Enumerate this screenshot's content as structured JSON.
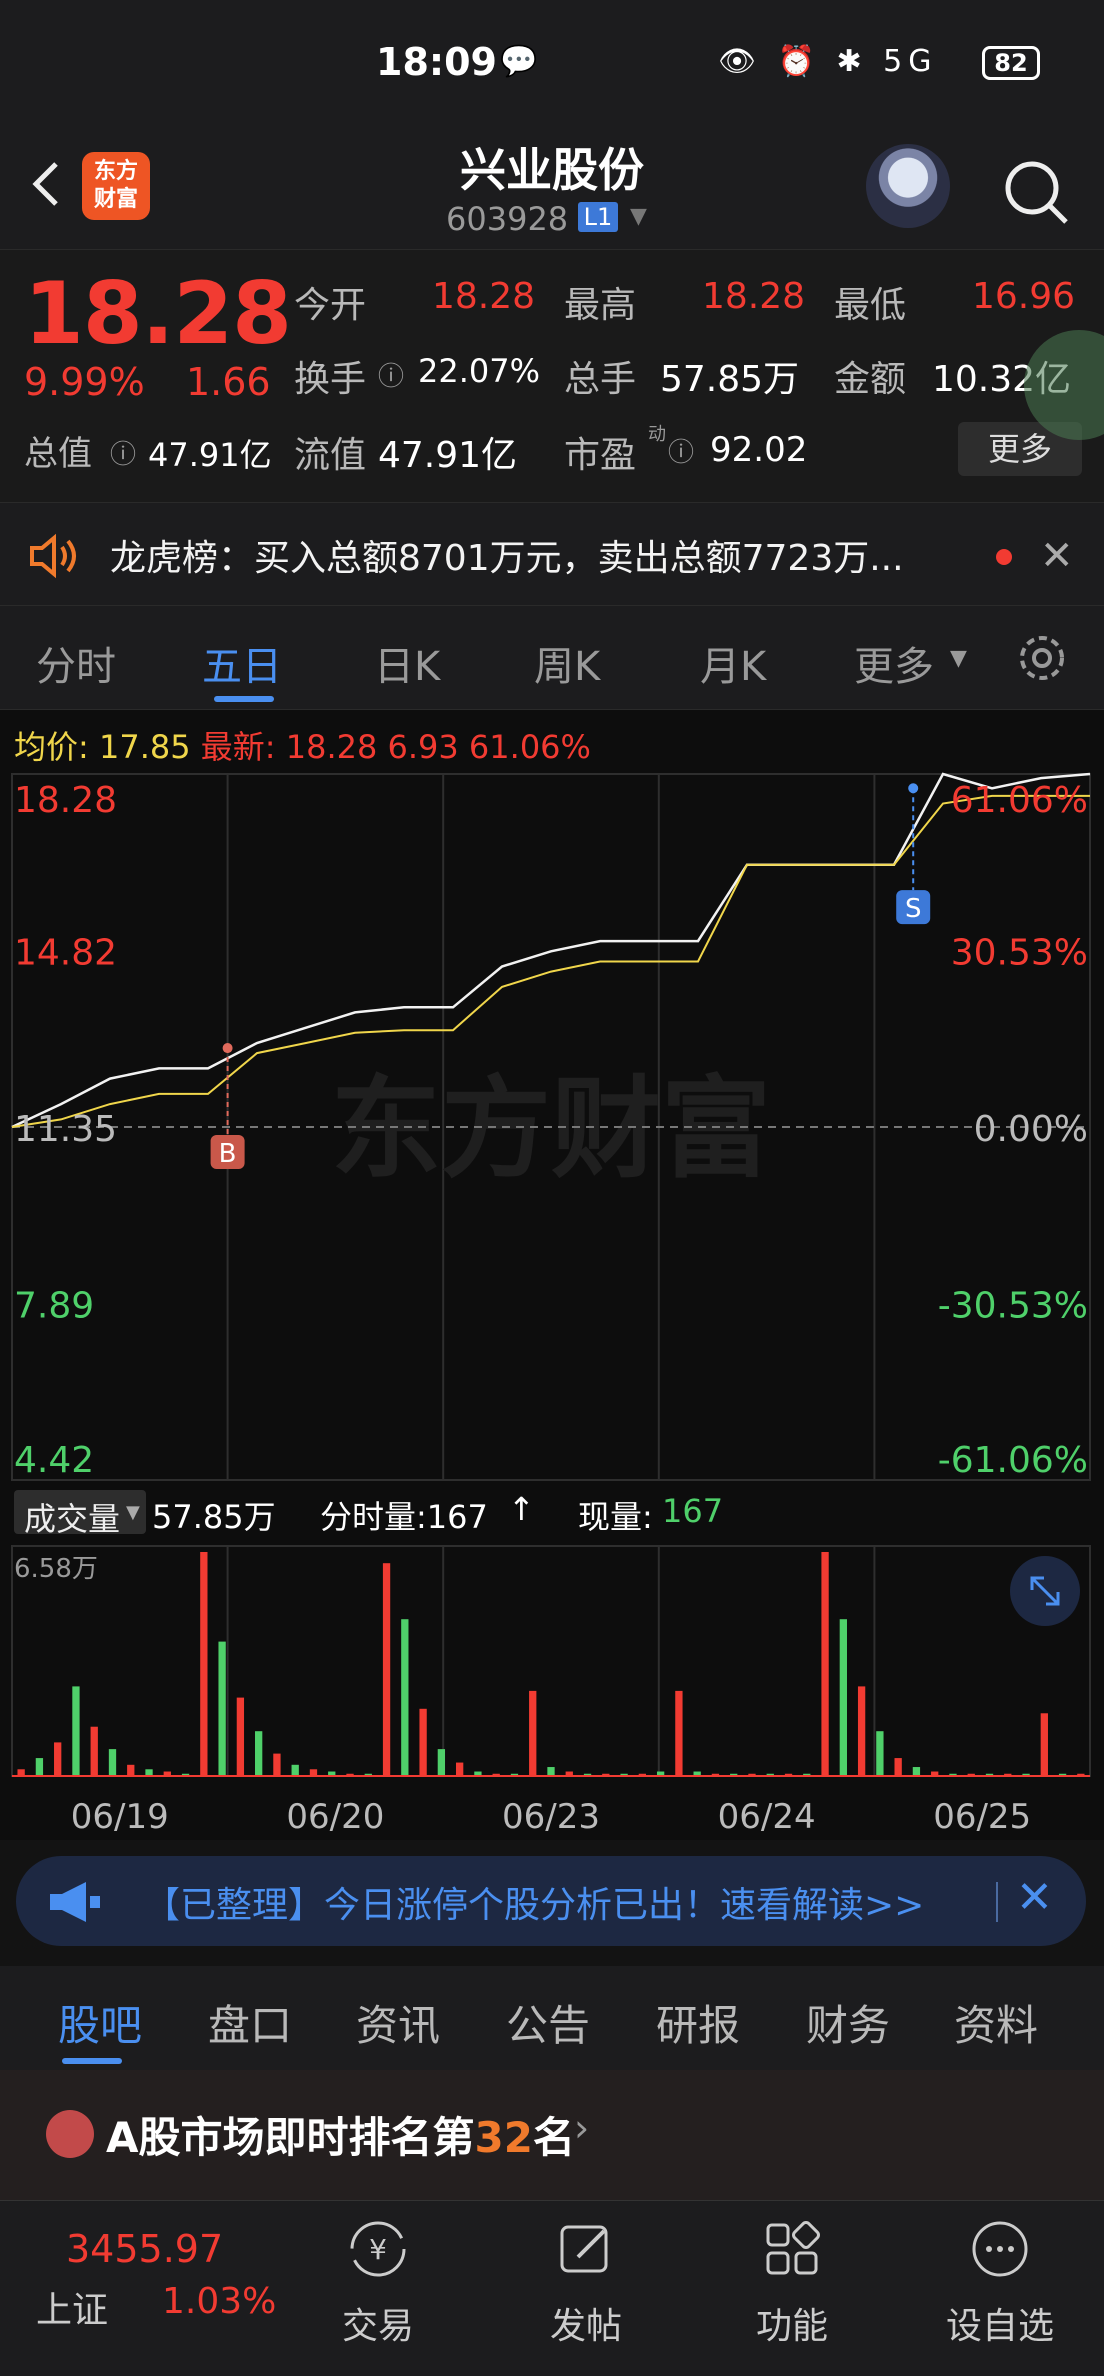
{
  "status_bar": {
    "time": "18:09",
    "right_icons": "👁 ⏰ ✱ 5G",
    "battery": "82"
  },
  "header": {
    "logo_text": "东方\n财富",
    "stock_name": "兴业股份",
    "stock_code": "603928",
    "level_badge": "L1"
  },
  "quote": {
    "price": "18.28",
    "change_pct": "9.99%",
    "change": "1.66",
    "total_value_label": "总值",
    "total_value": "47.91亿",
    "open_label": "今开",
    "open": "18.28",
    "high_label": "最高",
    "high": "18.28",
    "low_label": "最低",
    "low": "16.96",
    "turnover_label": "换手",
    "turnover": "22.07%",
    "volume_label": "总手",
    "volume": "57.85万",
    "amount_label": "金额",
    "amount": "10.32亿",
    "float_value_label": "流值",
    "float_value": "47.91亿",
    "pe_label": "市盈",
    "pe_sup": "动",
    "pe": "92.02",
    "more_label": "更多"
  },
  "notice": {
    "text": "龙虎榜：买入总额8701万元，卖出总额7723万..."
  },
  "period_tabs": [
    "分时",
    "五日",
    "日K",
    "周K",
    "月K",
    "更多"
  ],
  "chart_legend": {
    "avg_label": "均价:",
    "avg": "17.85",
    "latest_label": "最新:",
    "latest": "18.28",
    "change": "6.93",
    "change_pct": "61.06%"
  },
  "chart_data": {
    "type": "line",
    "title": "",
    "x": [
      "06/19",
      "06/20",
      "06/23",
      "06/24",
      "06/25"
    ],
    "y_ticks_left": [
      "18.28",
      "14.82",
      "11.35",
      "7.89",
      "4.42"
    ],
    "y_ticks_right": [
      "61.06%",
      "30.53%",
      "0.00%",
      "-30.53%",
      "-61.06%"
    ],
    "ylim": [
      4.42,
      18.28
    ],
    "base": 11.35,
    "series": [
      {
        "values": [
          11.35,
          11.8,
          12.3,
          12.5,
          12.5,
          13.0,
          13.3,
          13.6,
          13.7,
          13.7,
          14.5,
          14.8,
          15.0,
          15.0,
          15.0,
          16.5,
          16.5,
          16.5,
          16.5,
          18.28,
          18.0,
          18.2,
          18.28
        ]
      },
      {
        "values": [
          11.35,
          11.5,
          11.8,
          12.0,
          12.0,
          12.8,
          13.0,
          13.2,
          13.25,
          13.25,
          14.1,
          14.4,
          14.6,
          14.6,
          14.6,
          16.5,
          16.5,
          16.5,
          16.5,
          17.7,
          17.85,
          17.85,
          17.85
        ]
      }
    ],
    "markers": [
      {
        "label": "B"
      },
      {
        "label": "S"
      }
    ],
    "volume_label": "成交量",
    "volume_total": "57.85万",
    "tick_volume_label": "分时量:167",
    "tick_arrow": "↑",
    "now_volume_label": "现量:",
    "now_volume": "167",
    "volume_max": "6.58万",
    "volume": [
      3,
      8,
      15,
      40,
      22,
      12,
      5,
      3,
      2,
      1,
      100,
      60,
      35,
      20,
      10,
      5,
      3,
      2,
      1,
      1,
      95,
      70,
      30,
      12,
      6,
      2,
      1,
      1,
      38,
      4,
      2,
      1,
      1,
      1,
      1,
      2,
      38,
      2,
      1,
      1,
      1,
      1,
      1,
      1,
      100,
      70,
      40,
      20,
      8,
      4,
      2,
      1,
      1,
      1,
      1,
      1,
      28,
      1,
      1
    ]
  },
  "watermark": "东方财富",
  "banner": {
    "text": "【已整理】今日涨停个股分析已出！速看解读>>"
  },
  "info_tabs": [
    "股吧",
    "盘口",
    "资讯",
    "公告",
    "研报",
    "财务",
    "资料"
  ],
  "rank": {
    "prefix": "A股市场即时排名第",
    "num": "32",
    "suffix": "名"
  },
  "bottom_nav": {
    "index_value": "3455.97",
    "index_name": "上证",
    "index_pct": "1.03%",
    "items": [
      "交易",
      "发帖",
      "功能",
      "设自选"
    ]
  },
  "colors": {
    "up": "#f23b32",
    "down": "#4fd06a",
    "accent": "#4a8ff0",
    "avg_line": "#f0d64b"
  }
}
